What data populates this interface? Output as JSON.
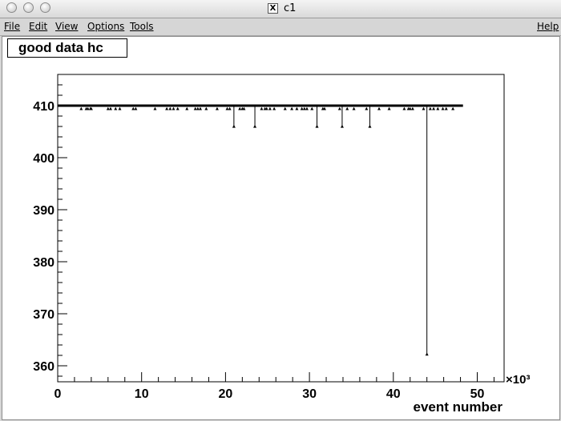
{
  "window": {
    "title": "c1"
  },
  "menu": {
    "file": "File",
    "edit": "Edit",
    "view": "View",
    "options": "Options",
    "tools": "Tools",
    "help": "Help"
  },
  "canvas": {
    "title": "good data hc"
  },
  "chart_data": {
    "type": "scatter",
    "title": "good data hc",
    "xlabel": "event number",
    "ylabel": "",
    "x_multiplier": "×10³",
    "xlim": [
      0,
      53
    ],
    "ylim": [
      357.5,
      416
    ],
    "xticks": [
      0,
      10,
      20,
      30,
      40,
      50
    ],
    "yticks": [
      360,
      370,
      380,
      390,
      400,
      410
    ],
    "baseline": {
      "value": 410,
      "x_start": 0,
      "x_end": 48.3
    },
    "series": [
      {
        "points": [
          {
            "x": 2.8,
            "y": 409.4
          },
          {
            "x": 3.4,
            "y": 409.4
          },
          {
            "x": 3.6,
            "y": 409.4
          },
          {
            "x": 3.9,
            "y": 409.4
          },
          {
            "x": 4.0,
            "y": 409.4
          },
          {
            "x": 6.0,
            "y": 409.4
          },
          {
            "x": 6.3,
            "y": 409.4
          },
          {
            "x": 6.9,
            "y": 409.4
          },
          {
            "x": 7.4,
            "y": 409.4
          },
          {
            "x": 9.0,
            "y": 409.4
          },
          {
            "x": 9.3,
            "y": 409.4
          },
          {
            "x": 11.6,
            "y": 409.4
          },
          {
            "x": 13.0,
            "y": 409.4
          },
          {
            "x": 13.4,
            "y": 409.4
          },
          {
            "x": 13.8,
            "y": 409.4
          },
          {
            "x": 14.3,
            "y": 409.4
          },
          {
            "x": 15.4,
            "y": 409.4
          },
          {
            "x": 16.4,
            "y": 409.4
          },
          {
            "x": 16.7,
            "y": 409.4
          },
          {
            "x": 17.0,
            "y": 409.4
          },
          {
            "x": 17.7,
            "y": 409.4
          },
          {
            "x": 19.0,
            "y": 409.4
          },
          {
            "x": 20.2,
            "y": 409.4
          },
          {
            "x": 20.5,
            "y": 409.4
          },
          {
            "x": 21.0,
            "y": 406.0
          },
          {
            "x": 21.7,
            "y": 409.4
          },
          {
            "x": 22.0,
            "y": 409.4
          },
          {
            "x": 22.2,
            "y": 409.4
          },
          {
            "x": 23.5,
            "y": 406.0
          },
          {
            "x": 24.3,
            "y": 409.4
          },
          {
            "x": 24.7,
            "y": 409.4
          },
          {
            "x": 24.9,
            "y": 409.4
          },
          {
            "x": 25.3,
            "y": 409.4
          },
          {
            "x": 25.8,
            "y": 409.4
          },
          {
            "x": 27.1,
            "y": 409.4
          },
          {
            "x": 27.9,
            "y": 409.4
          },
          {
            "x": 28.5,
            "y": 409.4
          },
          {
            "x": 29.1,
            "y": 409.4
          },
          {
            "x": 29.4,
            "y": 409.4
          },
          {
            "x": 29.7,
            "y": 409.4
          },
          {
            "x": 30.3,
            "y": 409.4
          },
          {
            "x": 30.9,
            "y": 406.0
          },
          {
            "x": 31.6,
            "y": 409.4
          },
          {
            "x": 31.8,
            "y": 409.4
          },
          {
            "x": 33.6,
            "y": 409.4
          },
          {
            "x": 33.9,
            "y": 406.0
          },
          {
            "x": 34.5,
            "y": 409.4
          },
          {
            "x": 35.3,
            "y": 409.4
          },
          {
            "x": 36.8,
            "y": 409.4
          },
          {
            "x": 37.2,
            "y": 406.0
          },
          {
            "x": 38.3,
            "y": 409.4
          },
          {
            "x": 39.5,
            "y": 409.4
          },
          {
            "x": 41.3,
            "y": 409.4
          },
          {
            "x": 41.8,
            "y": 409.4
          },
          {
            "x": 42.0,
            "y": 409.4
          },
          {
            "x": 42.3,
            "y": 409.4
          },
          {
            "x": 43.6,
            "y": 409.4
          },
          {
            "x": 44.0,
            "y": 362.2
          },
          {
            "x": 44.4,
            "y": 409.4
          },
          {
            "x": 44.8,
            "y": 409.4
          },
          {
            "x": 45.3,
            "y": 409.4
          },
          {
            "x": 45.9,
            "y": 409.4
          },
          {
            "x": 46.3,
            "y": 409.4
          },
          {
            "x": 47.1,
            "y": 409.4
          }
        ]
      }
    ],
    "grid": false
  }
}
